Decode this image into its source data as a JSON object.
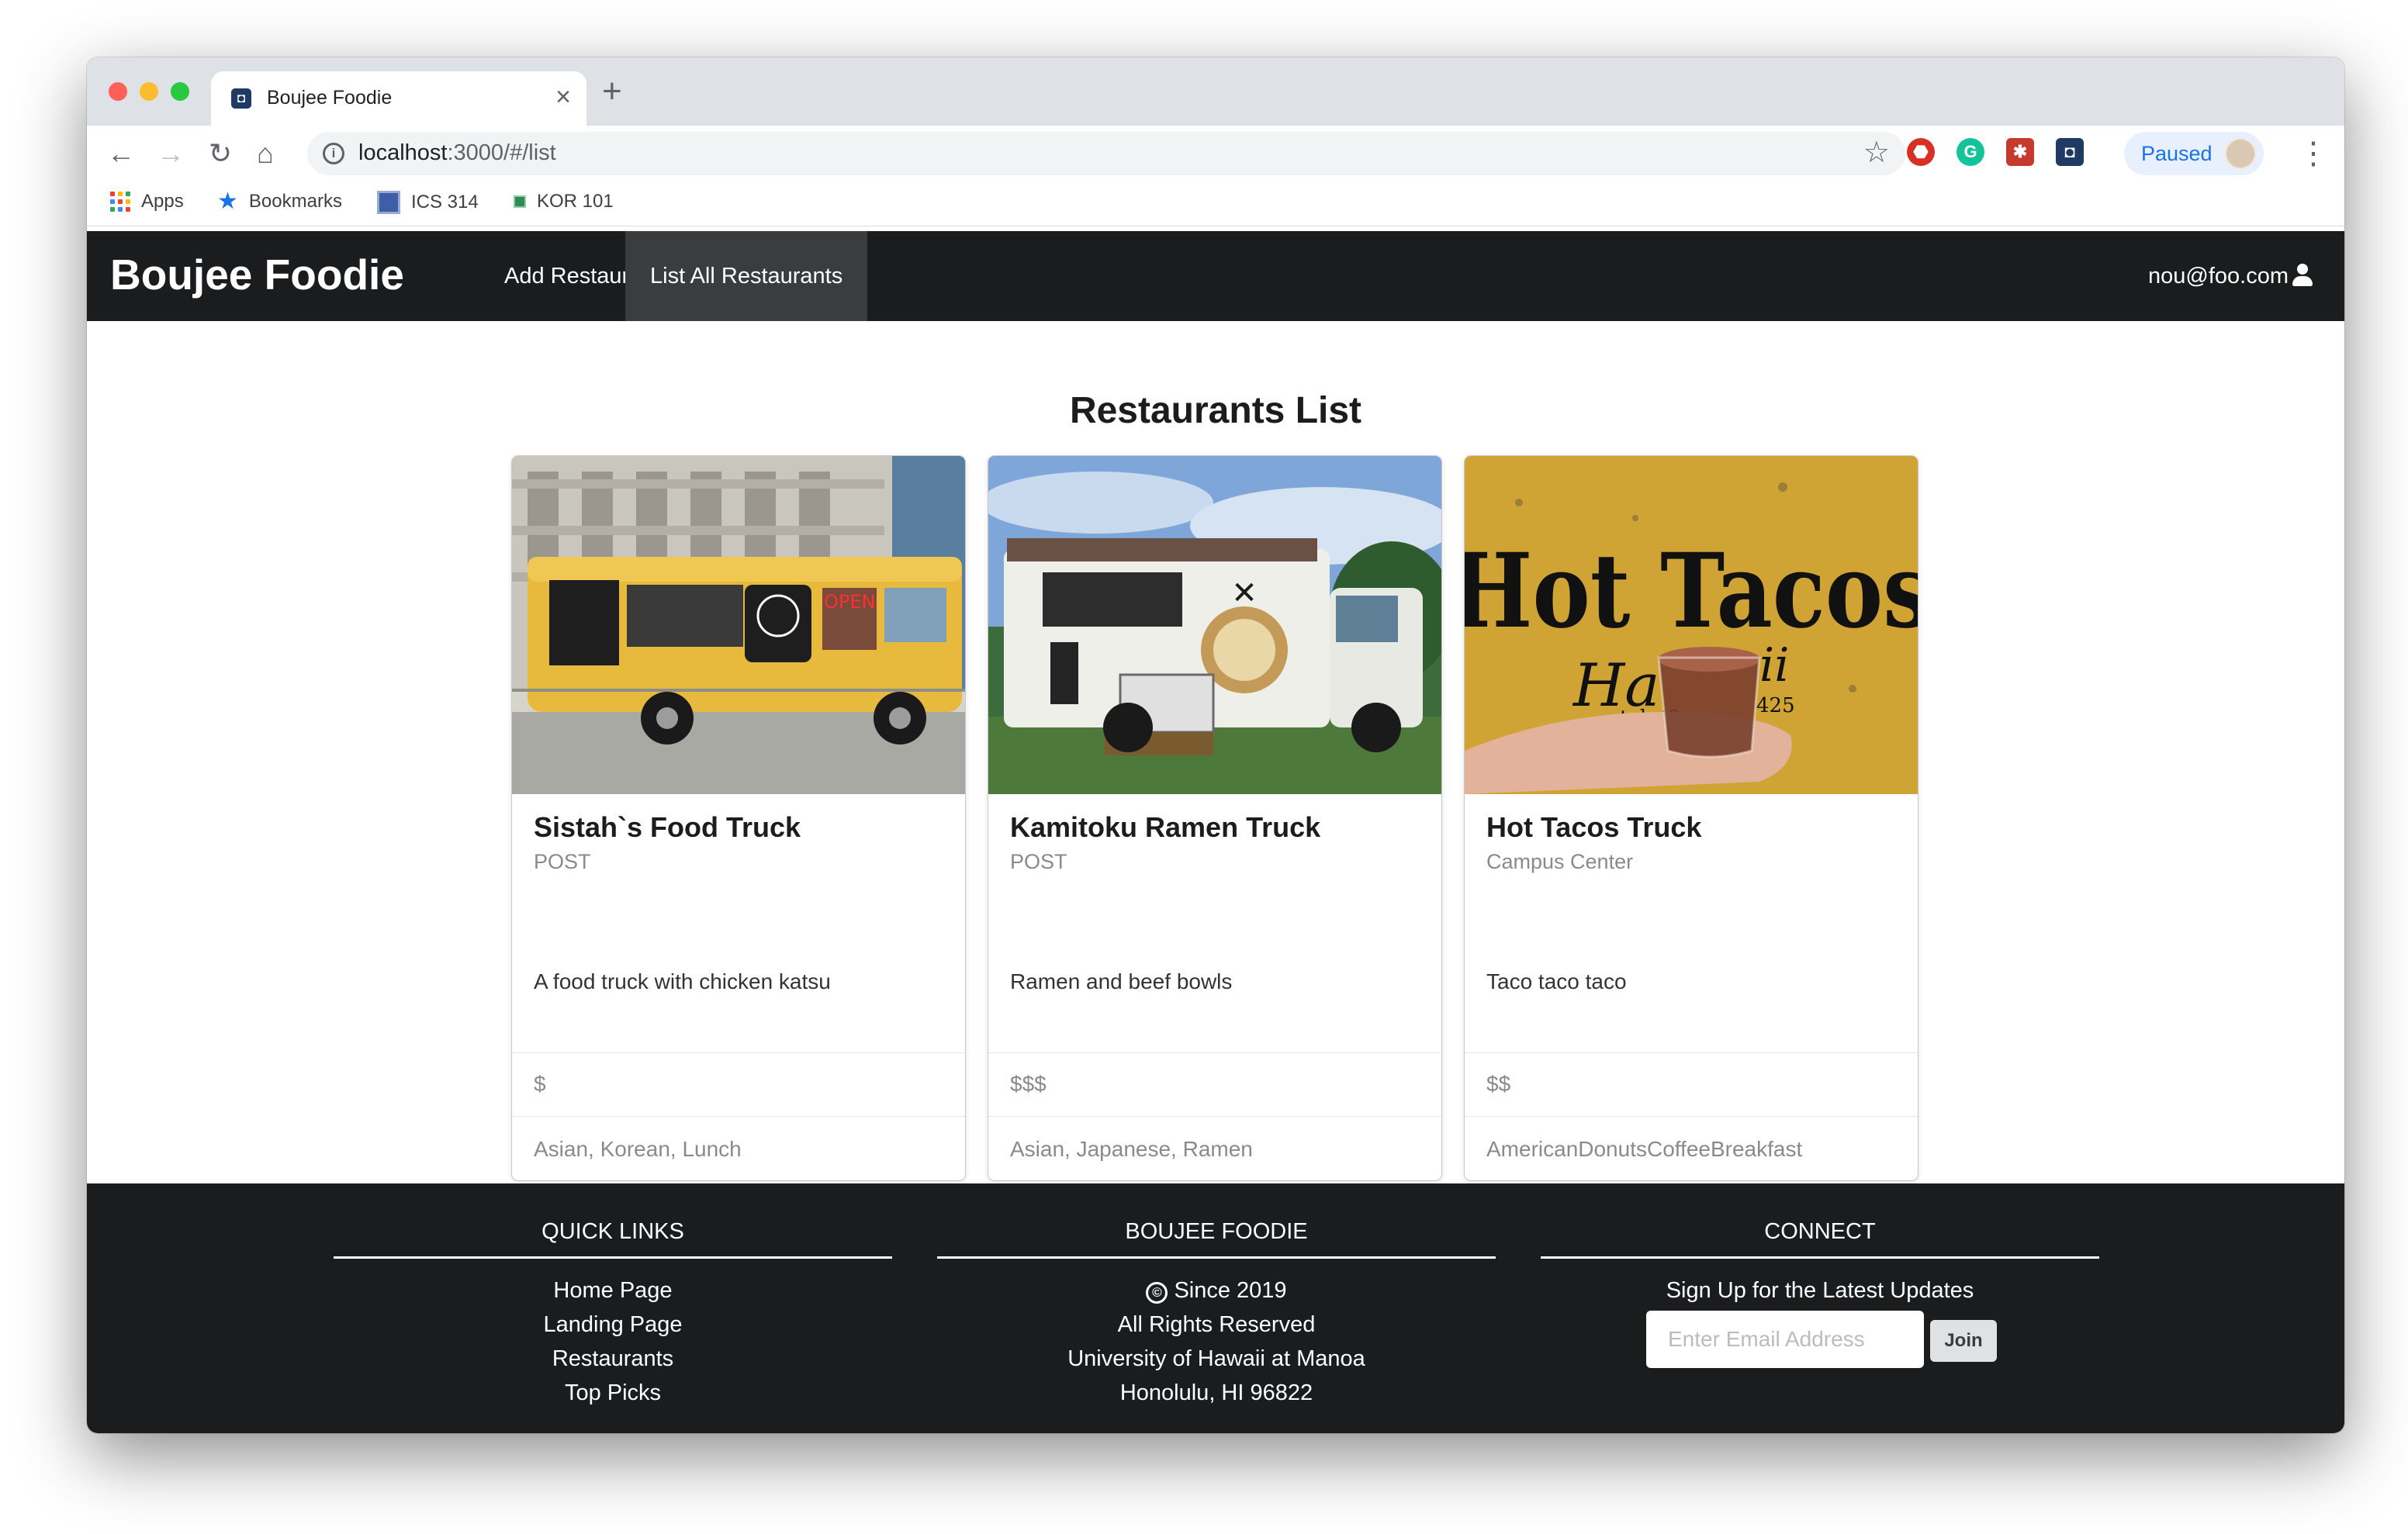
{
  "browser": {
    "tab_title": "Boujee Foodie",
    "url_host": "localhost",
    "url_path": ":3000/#/list",
    "profile_label": "Paused",
    "bookmarks": [
      "Apps",
      "Bookmarks",
      "ICS 314",
      "KOR 101"
    ]
  },
  "navbar": {
    "brand": "Boujee Foodie",
    "items": [
      {
        "label": "Add Restaurants",
        "active": false
      },
      {
        "label": "List All Restaurants",
        "active": true
      }
    ],
    "user": "nou@foo.com"
  },
  "main": {
    "title": "Restaurants List",
    "restaurants": [
      {
        "name": "Sistah`s Food Truck",
        "location": "POST",
        "description": "A food truck with chicken katsu",
        "price": "$",
        "tags": "Asian, Korean, Lunch",
        "image_sign": "OPEN"
      },
      {
        "name": "Kamitoku Ramen Truck",
        "location": "POST",
        "description": "Ramen and beef bowls",
        "price": "$$$",
        "tags": "Asian, Japanese, Ramen"
      },
      {
        "name": "Hot Tacos Truck",
        "location": "Campus Center",
        "description": "Taco taco taco",
        "price": "$$",
        "tags": "AmericanDonutsCoffeeBreakfast",
        "image_sign": "Hot Tacos",
        "image_sign2": "Ha",
        "image_sign3": "ii",
        "image_phone": "tel: (8",
        "image_phone2": "425"
      }
    ]
  },
  "footer": {
    "quick_links": {
      "heading": "QUICK LINKS",
      "links": [
        "Home Page",
        "Landing Page",
        "Restaurants",
        "Top Picks"
      ]
    },
    "about": {
      "heading": "BOUJEE FOODIE",
      "copyright_icon": "©",
      "lines": [
        "Since 2019",
        "All Rights Reserved",
        "University of Hawaii at Manoa",
        "Honolulu, HI 96822"
      ]
    },
    "connect": {
      "heading": "CONNECT",
      "subtitle": "Sign Up for the Latest Updates",
      "email_placeholder": "Enter Email Address",
      "join_label": "Join"
    }
  },
  "colors": {
    "navbar_bg": "#1b1c1d",
    "active_nav_bg": "#3b3c3d",
    "paused_accent": "#1a73e8"
  }
}
